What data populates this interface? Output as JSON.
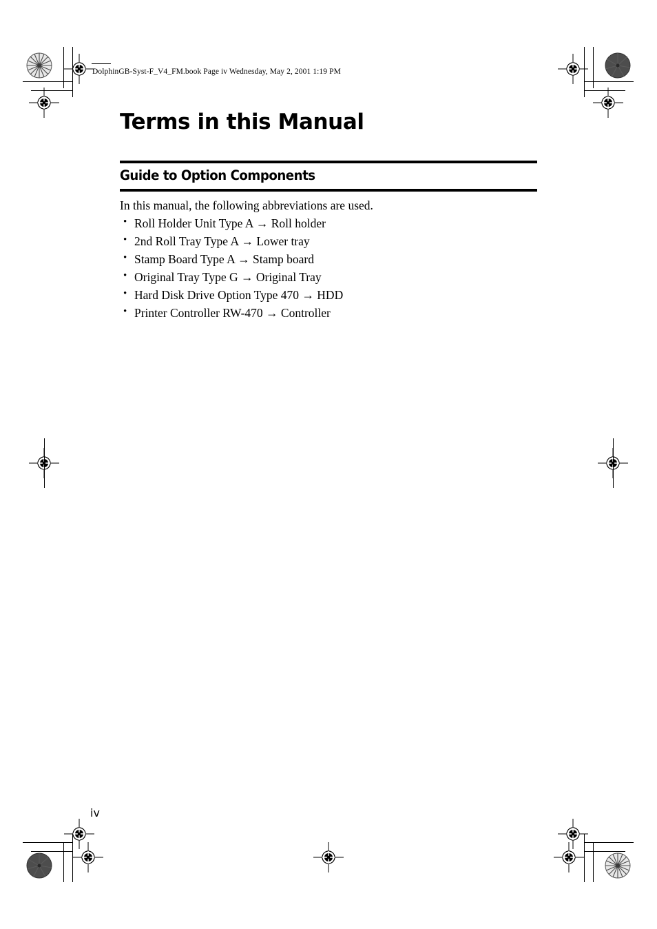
{
  "document": {
    "file_slug": "DolphinGB-Syst-F_V4_FM.book  Page iv  Wednesday, May 2, 2001  1:19 PM",
    "chapter_title": "Terms in this Manual",
    "section_title": "Guide to Option Components",
    "intro": "In this manual, the following abbreviations are used.",
    "bullet_glyph": "•",
    "arrow_glyph": "→",
    "terms": [
      {
        "source": "Roll Holder Unit Type A",
        "arrow": "→",
        "target": "Roll holder"
      },
      {
        "source": "2nd Roll Tray Type A",
        "arrow": "→",
        "target": "Lower tray"
      },
      {
        "source": "Stamp Board Type A",
        "arrow": "→",
        "target": "Stamp board"
      },
      {
        "source": "Original Tray Type G",
        "arrow": "→",
        "target": "Original Tray"
      },
      {
        "source": "Hard Disk Drive Option Type 470",
        "arrow": "→",
        "target": "HDD"
      },
      {
        "source": "Printer Controller RW-470",
        "arrow": "→",
        "target": "Controller"
      }
    ],
    "page_number": "iv"
  },
  "colors": {
    "ink": "#000000",
    "paper": "#ffffff",
    "halftone_dark": "#4a4a4a",
    "halftone_light": "#9a9a9a"
  }
}
